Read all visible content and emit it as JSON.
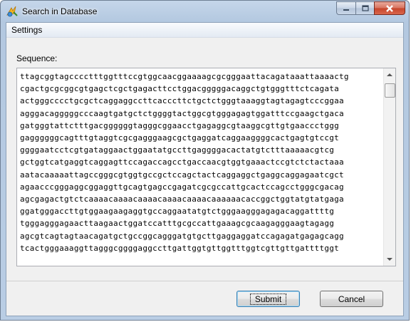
{
  "window": {
    "title": "Search in Database"
  },
  "menu": {
    "settings_label": "Settings"
  },
  "sequence": {
    "label": "Sequence:",
    "lines": [
      "ttagcggtagcccctttggtttccgtggcaacggaaaagcgcgggaattacagataaattaaaactg",
      "cgactgcgcggcgtgagctcgctgagacttcctggacgggggacaggctgtgggtttctcagata",
      "actgggcccctgcgctcaggaggccttcacccttctgctctgggtaaaggtagtagagtcccggaa",
      "agggacagggggcccaagtgatgctctggggtactggcgtgggagagtggatttccgaagctgaca",
      "gatgggtattctttgacggggggtagggcggaacctgagaggcgtaaggcgttgtgaaccctggg",
      "gaggggggcagtttgtaggtcgcgagggaagcgctgaggatcaggaaggggcactgagtgtccgt",
      "ggggaatcctcgtgataggaactggaatatgccttgaggggacactatgtctttaaaaacgtcg",
      "gctggtcatgaggtcaggagttccagaccagcctgaccaacgtggtgaaactccgtctctactaaa",
      "aatacaaaaattagccgggcgtggtgccgctccagctactcaggaggctgaggcaggagaatcgct",
      "agaacccgggaggcggaggttgcagtgagccgagatcgcgccattgcactccagcctgggcgacag",
      "agcgagactgtctcaaaacaaaacaaaacaaaacaaaacaaaaaacaccggctggtatgtatgaga",
      "ggatgggaccttgtggaagaagaggtgccaggaatatgtctgggaagggagagacaggattttg",
      "tgggagggagaacttaagaactggatccatttgcgccattgaaagcgcaagagggaagtagagg",
      "agcgtcagtagtaacagatgctgccggcagggatgtgcttgaggaggatccagagatgagagcagg",
      "tcactgggaaaggttagggcggggaggccttgattggtgttggtttggtcgttgttgattttggt"
    ]
  },
  "buttons": {
    "submit_label": "Submit",
    "cancel_label": "Cancel"
  }
}
